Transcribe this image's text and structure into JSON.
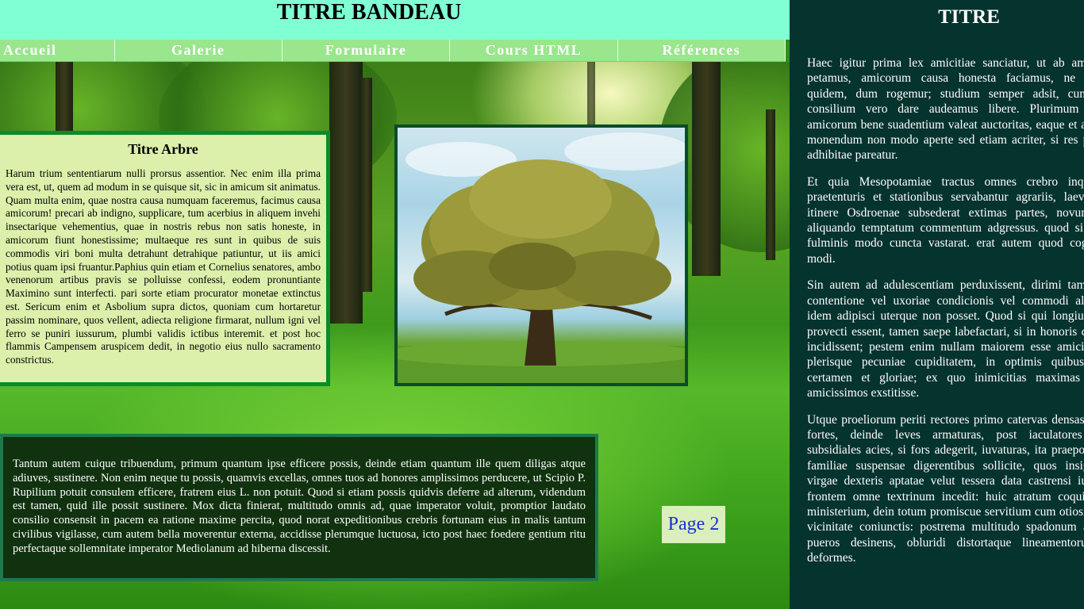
{
  "banner": {
    "title": "TITRE BANDEAU"
  },
  "nav": {
    "items": [
      {
        "label": "Accueil"
      },
      {
        "label": "Galerie"
      },
      {
        "label": "Formulaire"
      },
      {
        "label": "Cours HTML"
      },
      {
        "label": "Références"
      }
    ]
  },
  "arbre": {
    "title": "Titre Arbre",
    "text": "Harum trium sententiarum nulli prorsus assentior. Nec enim illa prima vera est, ut, quem ad modum in se quisque sit, sic in amicum sit animatus. Quam multa enim, quae nostra causa numquam faceremus, facimus causa amicorum! precari ab indigno, supplicare, tum acerbius in aliquem invehi insectarique vehementius, quae in nostris rebus non satis honeste, in amicorum fiunt honestissime; multaeque res sunt in quibus de suis commodis viri boni multa detrahunt detrahique patiuntur, ut iis amici potius quam ipsi fruantur.Paphius quin etiam et Cornelius senatores, ambo venenorum artibus pravis se polluisse confessi, eodem pronuntiante Maximino sunt interfecti. pari sorte etiam procurator monetae extinctus est. Sericum enim et Asbolium supra dictos, quoniam cum hortaretur passim nominare, quos vellent, adiecta religione firmarat, nullum igni vel ferro se puniri iussurum, plumbi validis ictibus interemit. et post hoc flammis Campensem aruspicem dedit, in negotio eius nullo sacramento constrictus."
  },
  "bottom": {
    "text": "Tantum autem cuique tribuendum, primum quantum ipse efficere possis, deinde etiam quantum ille quem diligas atque adiuves, sustinere. Non enim neque tu possis, quamvis excellas, omnes tuos ad honores amplissimos perducere, ut Scipio P. Rupilium potuit consulem efficere, fratrem eius L. non potuit. Quod si etiam possis quidvis deferre ad alterum, videndum est tamen, quid ille possit sustinere. Mox dicta finierat, multitudo omnis ad, quae imperator voluit, promptior laudato consilio consensit in pacem ea ratione maxime percita, quod norat expeditionibus crebris fortunam eius in malis tantum civilibus vigilasse, cum autem bella moverentur externa, accidisse plerumque luctuosa, icto post haec foedere gentium ritu perfectaque sollemnitate imperator Mediolanum ad hiberna discessit."
  },
  "page_link": {
    "label": "Page 2"
  },
  "sidebar": {
    "title": "TITRE",
    "paragraphs": [
      "Haec igitur prima lex amicitiae sanciatur, ut ab amicis honesta petamus, amicorum causa honesta faciamus, ne exspectemus quidem, dum rogemur; studium semper adsit, cunctatio absit; consilium vero dare audeamus libere. Plurimum in amicitia amicorum bene suadentium valeat auctoritas, eaque et adhibeatur ad monendum non modo aperte sed etiam acriter, si res postulabit, et adhibitae pareatur.",
      "Et quia Mesopotamiae tractus omnes crebro inquietari sueti praetenturis et stationibus servabantur agrariis, laevorsum flexo itinere Osdroenae subsederat extimas partes, novum parumque aliquando temptatum commentum adgressus. quod si impetrasset, fulminis modo cuncta vastarat. erat autem quod cogitabat huius modi.",
      "Sin autem ad adulescentiam perduxissent, dirimi tamen interdum contentione vel uxoriae condicionis vel commodi alicuius, quod idem adipisci uterque non posset. Quod si qui longius in amicitia provecti essent, tamen saepe labefactari, si in honoris contentionem incidissent; pestem enim nullam maiorem esse amicitiis quam in plerisque pecuniae cupiditatem, in optimis quibusque honoris certamen et gloriae; ex quo inimicitias maximas saepe inter amicissimos exstitisse.",
      "Utque proeliorum periti rectores primo catervas densas opponunt et fortes, deinde leves armaturas, post iaculatores ultimasque subsidiales acies, si fors adegerit, iuvaturas, ita praepositis urbanae familiae suspensae digerentibus sollicite, quos insignes faciunt virgae dexteris aptatae velut tessera data castrensi iuxta vehiculi frontem omne textrinum incedit: huic atratum coquinae iungitur ministerium, dein totum promiscue servitium cum otiosis plebeiis de vicinitate coniunctis: postrema multitudo spadonum a senibus in pueros desinens, obluridi distortaque lineamentorum conpage deformes."
    ]
  },
  "colors": {
    "banner": "#80ffd4",
    "nav": "#99e68c",
    "sidebar": "#05332e",
    "arbre_box": "#dcf0ac",
    "dark_box": "#10320f"
  }
}
